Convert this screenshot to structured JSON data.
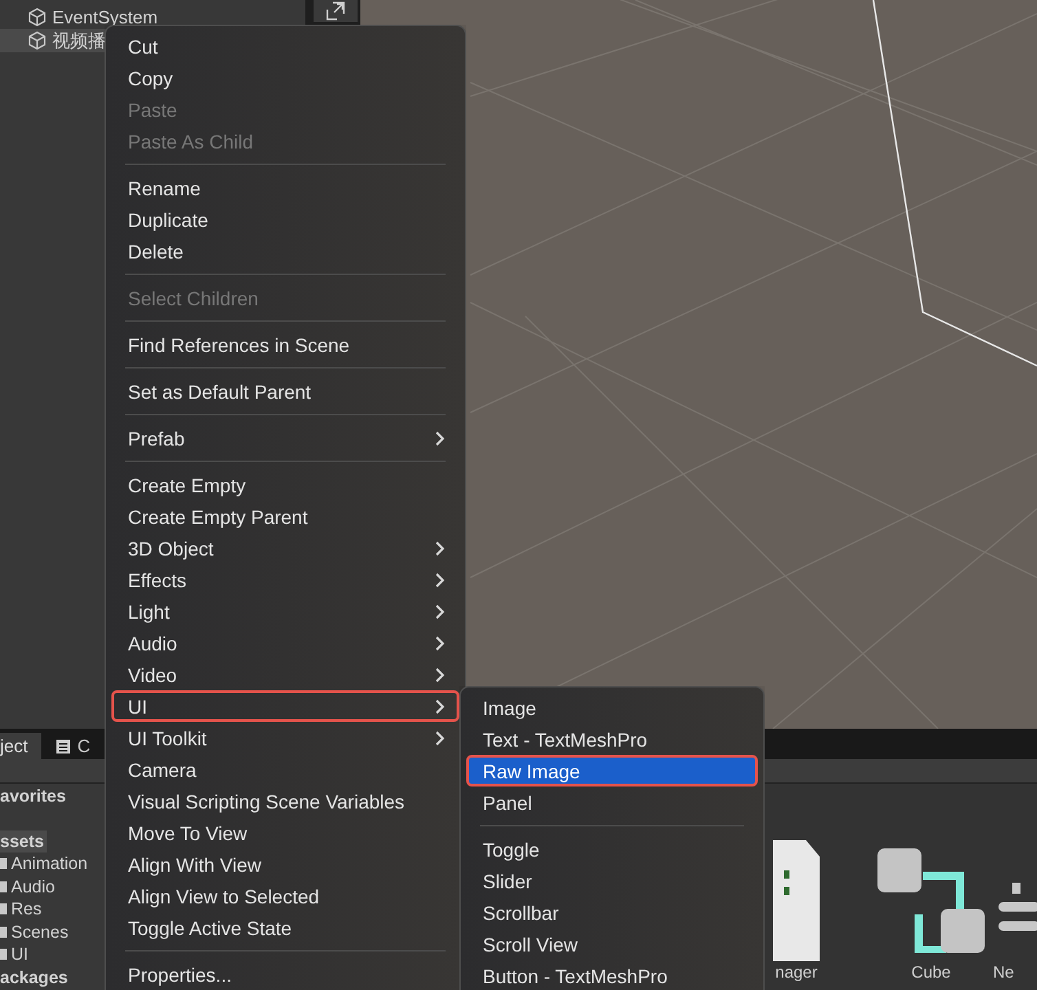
{
  "hierarchy": {
    "items": [
      {
        "label": "EventSystem",
        "selected": false
      },
      {
        "label": "视频播",
        "selected": true
      }
    ]
  },
  "context_menu": {
    "items": [
      {
        "kind": "item",
        "label": "Cut",
        "disabled": false,
        "submenu": false,
        "selected": false
      },
      {
        "kind": "item",
        "label": "Copy",
        "disabled": false,
        "submenu": false,
        "selected": false
      },
      {
        "kind": "item",
        "label": "Paste",
        "disabled": true,
        "submenu": false,
        "selected": false
      },
      {
        "kind": "item",
        "label": "Paste As Child",
        "disabled": true,
        "submenu": false,
        "selected": false
      },
      {
        "kind": "separator"
      },
      {
        "kind": "item",
        "label": "Rename",
        "disabled": false,
        "submenu": false,
        "selected": false
      },
      {
        "kind": "item",
        "label": "Duplicate",
        "disabled": false,
        "submenu": false,
        "selected": false
      },
      {
        "kind": "item",
        "label": "Delete",
        "disabled": false,
        "submenu": false,
        "selected": false
      },
      {
        "kind": "separator"
      },
      {
        "kind": "item",
        "label": "Select Children",
        "disabled": true,
        "submenu": false,
        "selected": false
      },
      {
        "kind": "separator"
      },
      {
        "kind": "item",
        "label": "Find References in Scene",
        "disabled": false,
        "submenu": false,
        "selected": false
      },
      {
        "kind": "separator"
      },
      {
        "kind": "item",
        "label": "Set as Default Parent",
        "disabled": false,
        "submenu": false,
        "selected": false
      },
      {
        "kind": "separator"
      },
      {
        "kind": "item",
        "label": "Prefab",
        "disabled": false,
        "submenu": true,
        "selected": false
      },
      {
        "kind": "separator"
      },
      {
        "kind": "item",
        "label": "Create Empty",
        "disabled": false,
        "submenu": false,
        "selected": false
      },
      {
        "kind": "item",
        "label": "Create Empty Parent",
        "disabled": false,
        "submenu": false,
        "selected": false
      },
      {
        "kind": "item",
        "label": "3D Object",
        "disabled": false,
        "submenu": true,
        "selected": false
      },
      {
        "kind": "item",
        "label": "Effects",
        "disabled": false,
        "submenu": true,
        "selected": false
      },
      {
        "kind": "item",
        "label": "Light",
        "disabled": false,
        "submenu": true,
        "selected": false
      },
      {
        "kind": "item",
        "label": "Audio",
        "disabled": false,
        "submenu": true,
        "selected": false
      },
      {
        "kind": "item",
        "label": "Video",
        "disabled": false,
        "submenu": true,
        "selected": false
      },
      {
        "kind": "item",
        "label": "UI",
        "disabled": false,
        "submenu": true,
        "selected": true
      },
      {
        "kind": "item",
        "label": "UI Toolkit",
        "disabled": false,
        "submenu": true,
        "selected": false
      },
      {
        "kind": "item",
        "label": "Camera",
        "disabled": false,
        "submenu": false,
        "selected": false
      },
      {
        "kind": "item",
        "label": "Visual Scripting Scene Variables",
        "disabled": false,
        "submenu": false,
        "selected": false
      },
      {
        "kind": "item",
        "label": "Move To View",
        "disabled": false,
        "submenu": false,
        "selected": false
      },
      {
        "kind": "item",
        "label": "Align With View",
        "disabled": false,
        "submenu": false,
        "selected": false
      },
      {
        "kind": "item",
        "label": "Align View to Selected",
        "disabled": false,
        "submenu": false,
        "selected": false
      },
      {
        "kind": "item",
        "label": "Toggle Active State",
        "disabled": false,
        "submenu": false,
        "selected": false
      },
      {
        "kind": "separator"
      },
      {
        "kind": "item",
        "label": "Properties...",
        "disabled": false,
        "submenu": false,
        "selected": false
      }
    ]
  },
  "submenu": {
    "items": [
      {
        "kind": "item",
        "label": "Image",
        "disabled": false,
        "submenu": false,
        "selected": false
      },
      {
        "kind": "item",
        "label": "Text - TextMeshPro",
        "disabled": false,
        "submenu": false,
        "selected": false
      },
      {
        "kind": "item",
        "label": "Raw Image",
        "disabled": false,
        "submenu": false,
        "selected": true
      },
      {
        "kind": "item",
        "label": "Panel",
        "disabled": false,
        "submenu": false,
        "selected": false
      },
      {
        "kind": "separator"
      },
      {
        "kind": "item",
        "label": "Toggle",
        "disabled": false,
        "submenu": false,
        "selected": false
      },
      {
        "kind": "item",
        "label": "Slider",
        "disabled": false,
        "submenu": false,
        "selected": false
      },
      {
        "kind": "item",
        "label": "Scrollbar",
        "disabled": false,
        "submenu": false,
        "selected": false
      },
      {
        "kind": "item",
        "label": "Scroll View",
        "disabled": false,
        "submenu": false,
        "selected": false
      },
      {
        "kind": "item",
        "label": "Button - TextMeshPro",
        "disabled": false,
        "submenu": false,
        "selected": false
      }
    ]
  },
  "project": {
    "tabs": [
      {
        "label": "ject",
        "selected": true
      },
      {
        "label": "C",
        "selected": false
      }
    ],
    "tree": [
      {
        "label": "avorites",
        "selected": false
      },
      {
        "label": "ssets",
        "selected": true,
        "children": [
          {
            "label": "Animation",
            "selected": false
          },
          {
            "label": "Audio",
            "selected": false
          },
          {
            "label": "Res",
            "selected": false
          },
          {
            "label": "Scenes",
            "selected": false
          },
          {
            "label": "UI",
            "selected": false
          }
        ]
      },
      {
        "label": "ackages",
        "selected": false
      }
    ],
    "assets": [
      {
        "label": "nager",
        "kind": "script"
      },
      {
        "label": "Cube",
        "kind": "prefab"
      },
      {
        "label": "Ne",
        "kind": "list"
      }
    ]
  }
}
